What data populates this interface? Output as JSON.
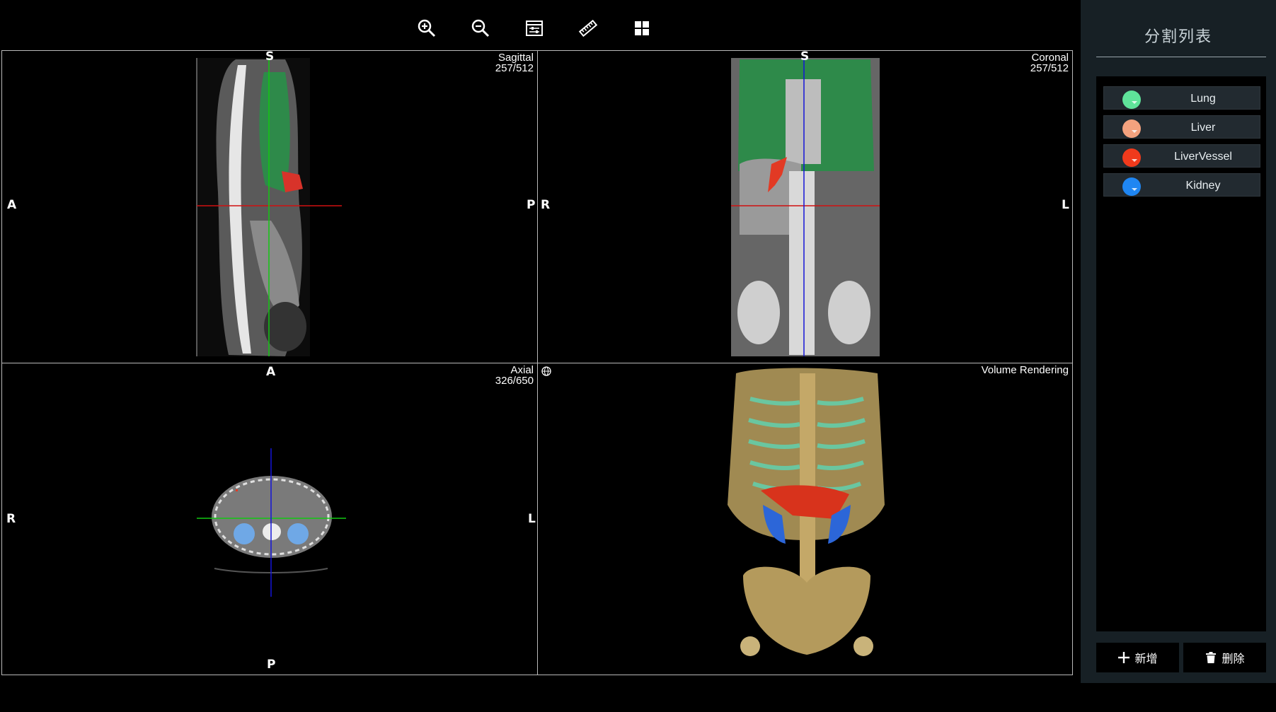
{
  "toolbar": {
    "tools": [
      "zoom-in-icon",
      "zoom-out-icon",
      "window-level-icon",
      "ruler-icon",
      "layout-grid-icon"
    ]
  },
  "viewports": {
    "sagittal": {
      "name": "Sagittal",
      "slice": "257/512",
      "orient_top": "S",
      "orient_left": "A",
      "orient_right": "P"
    },
    "coronal": {
      "name": "Coronal",
      "slice": "257/512",
      "orient_top": "S",
      "orient_left": "R",
      "orient_right": "L"
    },
    "axial": {
      "name": "Axial",
      "slice": "326/650",
      "orient_top": "A",
      "orient_bottom": "P",
      "orient_left": "R",
      "orient_right": "L"
    },
    "volume": {
      "name": "Volume Rendering"
    }
  },
  "sidebar": {
    "title": "分割列表",
    "segments": [
      {
        "name": "Lung",
        "color": "#5fe39a"
      },
      {
        "name": "Liver",
        "color": "#f4a27e"
      },
      {
        "name": "LiverVessel",
        "color": "#f03a1c"
      },
      {
        "name": "Kidney",
        "color": "#1f86f2"
      }
    ],
    "add_label": "新增",
    "delete_label": "删除"
  },
  "colors": {
    "crosshair_red": "#d01010",
    "crosshair_green": "#12c812",
    "crosshair_blue": "#1414d8",
    "sidebar_bg": "#172025"
  }
}
